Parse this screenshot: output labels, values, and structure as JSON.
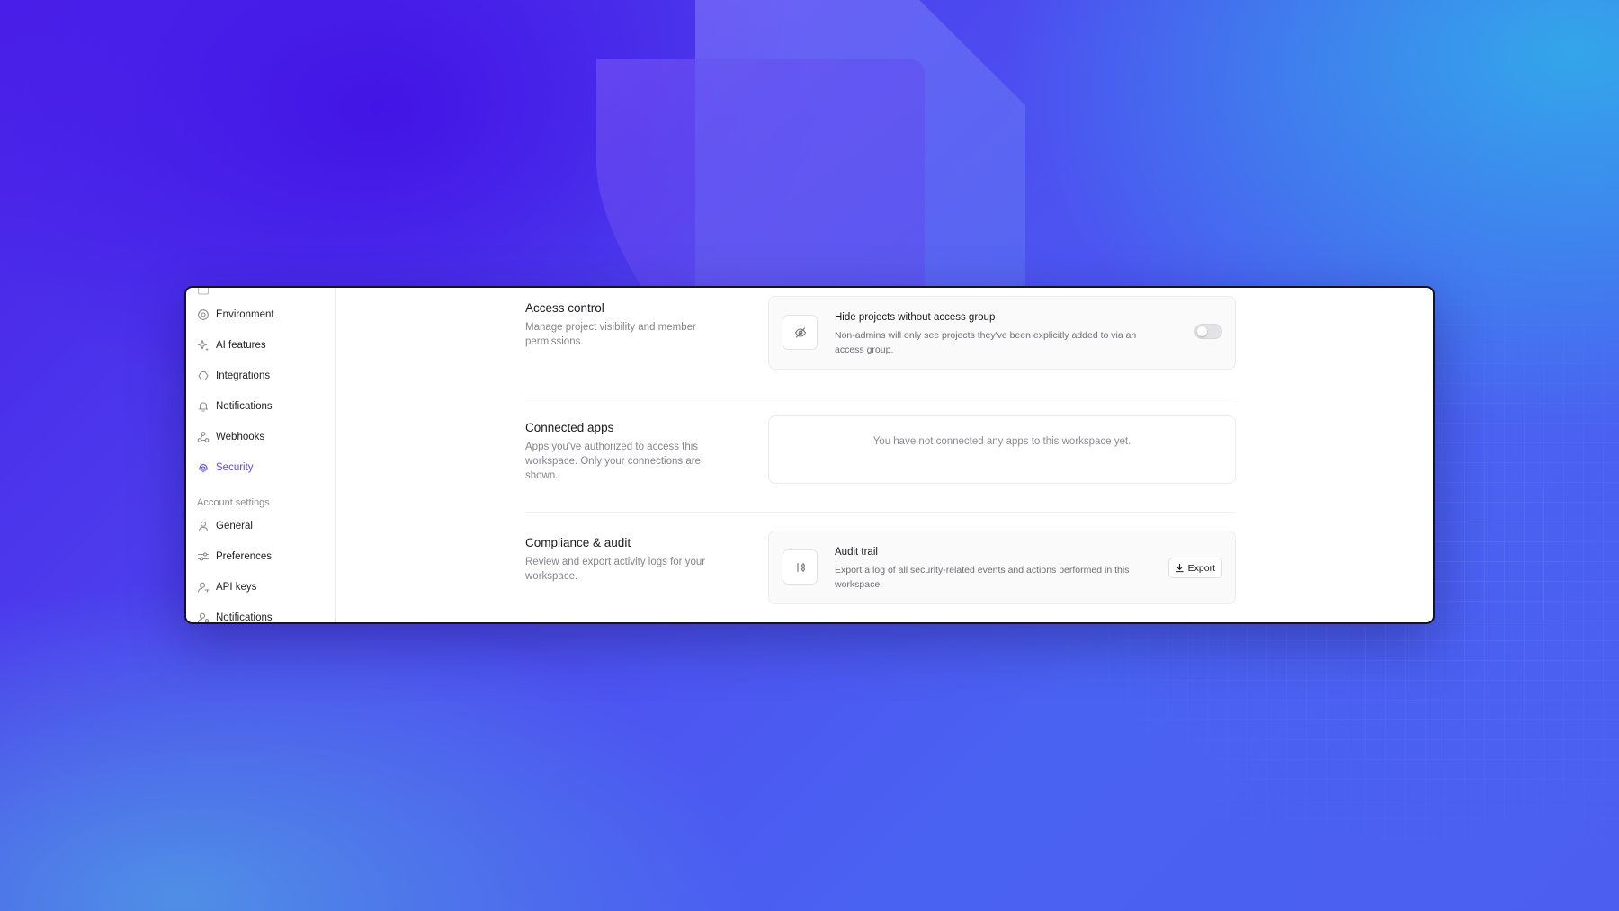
{
  "sidebar": {
    "items": [
      {
        "label": "Environment",
        "icon": "environment-icon",
        "active": false
      },
      {
        "label": "AI features",
        "icon": "sparkle-icon",
        "active": false
      },
      {
        "label": "Integrations",
        "icon": "integrations-icon",
        "active": false
      },
      {
        "label": "Notifications",
        "icon": "bell-icon",
        "active": false
      },
      {
        "label": "Webhooks",
        "icon": "webhook-icon",
        "active": false
      },
      {
        "label": "Security",
        "icon": "fingerprint-icon",
        "active": true
      }
    ],
    "account_heading": "Account settings",
    "account_items": [
      {
        "label": "General",
        "icon": "user-icon"
      },
      {
        "label": "Preferences",
        "icon": "sliders-icon"
      },
      {
        "label": "API keys",
        "icon": "key-user-icon"
      },
      {
        "label": "Notifications",
        "icon": "user-bell-icon"
      }
    ]
  },
  "sections": {
    "access": {
      "title": "Access control",
      "description": "Manage project visibility and member permissions.",
      "card": {
        "title": "Hide projects without access group",
        "description": "Non-admins will only see projects they've been explicitly added to via an access group.",
        "icon": "eye-off-icon",
        "toggle_on": false
      }
    },
    "connected": {
      "title": "Connected apps",
      "description": "Apps you've authorized to access this workspace. Only your connections are shown.",
      "empty_message": "You have not connected any apps to this workspace yet."
    },
    "compliance": {
      "title": "Compliance & audit",
      "description": "Review and export activity logs for your workspace.",
      "card": {
        "title": "Audit trail",
        "description": "Export a log of all security-related events and actions performed in this workspace.",
        "icon": "audit-icon",
        "button_label": "Export"
      }
    }
  },
  "colors": {
    "accent": "#5b4bd6",
    "background_primary": "#4a1fe8",
    "background_secondary": "#33a6ea"
  }
}
